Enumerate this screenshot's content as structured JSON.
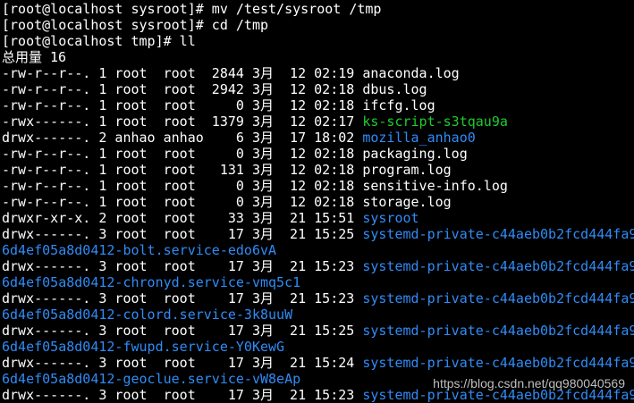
{
  "theme": {
    "background": "#000000",
    "text": "#ffffff",
    "dir_color": "#2f8cf6",
    "exec_color": "#1dcc2f"
  },
  "lines": [
    {
      "text": "[root@localhost sysroot]# mv /test/sysroot /tmp"
    },
    {
      "text": "[root@localhost sysroot]# cd /tmp"
    },
    {
      "text": "[root@localhost tmp]# ll"
    },
    {
      "text": "总用量 16"
    },
    {
      "text": "-rw-r--r--. 1 root  root  2844 3月  12 02:19 ",
      "name": "anaconda.log",
      "type": "file"
    },
    {
      "text": "-rw-r--r--. 1 root  root  2942 3月  12 02:18 ",
      "name": "dbus.log",
      "type": "file"
    },
    {
      "text": "-rw-r--r--. 1 root  root     0 3月  12 02:18 ",
      "name": "ifcfg.log",
      "type": "file"
    },
    {
      "text": "-rwx------. 1 root  root  1379 3月  12 02:17 ",
      "name": "ks-script-s3tqau9a",
      "type": "exec"
    },
    {
      "text": "drwx------. 2 anhao anhao    6 3月  17 18:02 ",
      "name": "mozilla_anhao0",
      "type": "dir"
    },
    {
      "text": "-rw-r--r--. 1 root  root     0 3月  12 02:18 ",
      "name": "packaging.log",
      "type": "file"
    },
    {
      "text": "-rw-r--r--. 1 root  root   131 3月  12 02:18 ",
      "name": "program.log",
      "type": "file"
    },
    {
      "text": "-rw-r--r--. 1 root  root     0 3月  12 02:18 ",
      "name": "sensitive-info.log",
      "type": "file"
    },
    {
      "text": "-rw-r--r--. 1 root  root     0 3月  12 02:18 ",
      "name": "storage.log",
      "type": "file"
    },
    {
      "text": "drwxr-xr-x. 2 root  root    33 3月  21 15:51 ",
      "name": "sysroot",
      "type": "dir"
    },
    {
      "text": "drwx------. 3 root  root    17 3月  21 15:25 ",
      "name": "systemd-private-c44aeb0b2fcd444fa9",
      "type": "dir"
    },
    {
      "text": "",
      "name": "6d4ef05a8d0412-bolt.service-edo6vA",
      "type": "dir"
    },
    {
      "text": "drwx------. 3 root  root    17 3月  21 15:23 ",
      "name": "systemd-private-c44aeb0b2fcd444fa9",
      "type": "dir"
    },
    {
      "text": "",
      "name": "6d4ef05a8d0412-chronyd.service-vmq5c1",
      "type": "dir"
    },
    {
      "text": "drwx------. 3 root  root    17 3月  21 15:23 ",
      "name": "systemd-private-c44aeb0b2fcd444fa9",
      "type": "dir"
    },
    {
      "text": "",
      "name": "6d4ef05a8d0412-colord.service-3k8uuW",
      "type": "dir"
    },
    {
      "text": "drwx------. 3 root  root    17 3月  21 15:25 ",
      "name": "systemd-private-c44aeb0b2fcd444fa9",
      "type": "dir"
    },
    {
      "text": "",
      "name": "6d4ef05a8d0412-fwupd.service-Y0KewG",
      "type": "dir"
    },
    {
      "text": "drwx------. 3 root  root    17 3月  21 15:24 ",
      "name": "systemd-private-c44aeb0b2fcd444fa9",
      "type": "dir"
    },
    {
      "text": "",
      "name": "6d4ef05a8d0412-geoclue.service-vW8eAp",
      "type": "dir"
    },
    {
      "text": "drwx------. 3 root  root    17 3月  21 15:23 ",
      "name": "systemd-private-c44aeb0b2fcd444fa9",
      "type": "dir"
    }
  ],
  "watermark": "https://blog.csdn.net/qq980040569"
}
